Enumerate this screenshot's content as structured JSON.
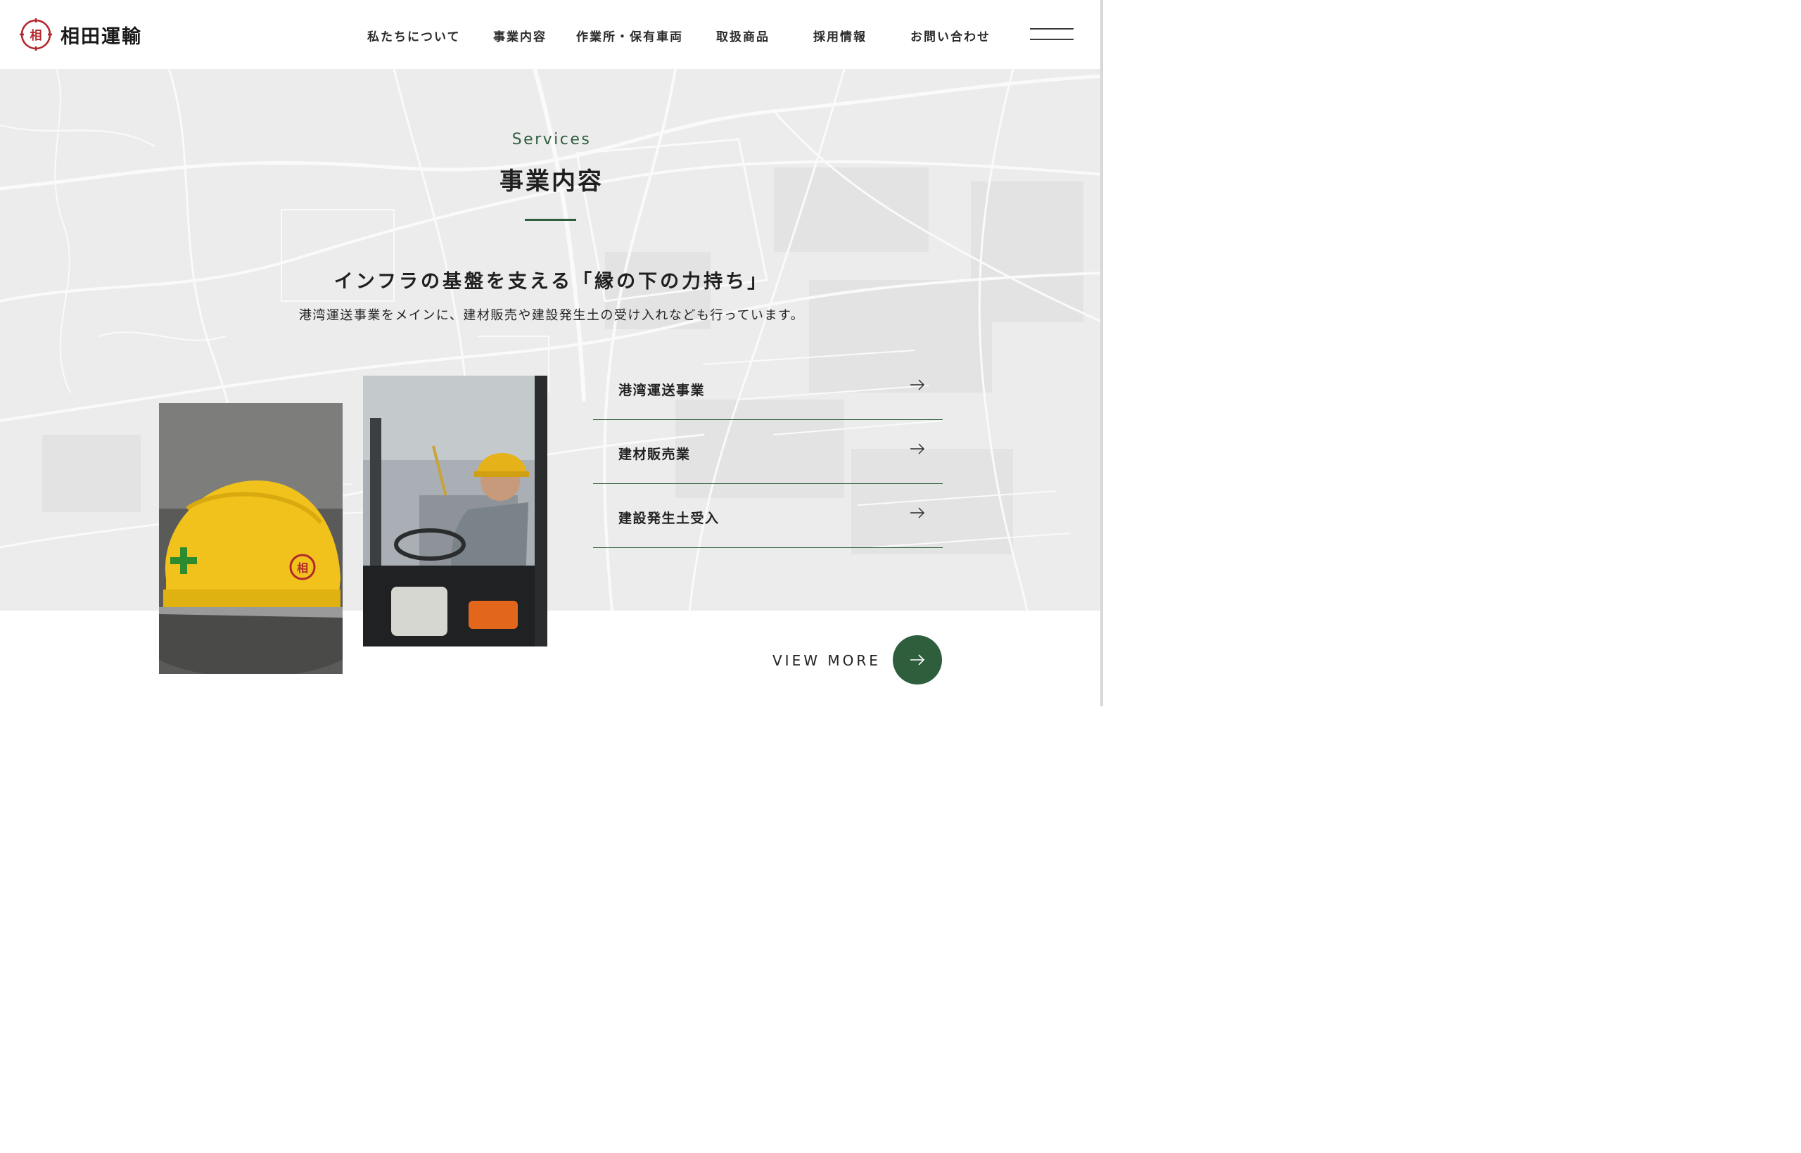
{
  "brand": {
    "name": "相田運輸",
    "mark_char": "相",
    "accent_red": "#b3272d"
  },
  "nav": {
    "items": [
      {
        "label": "私たちについて"
      },
      {
        "label": "事業内容"
      },
      {
        "label": "作業所・保有車両"
      },
      {
        "label": "取扱商品"
      },
      {
        "label": "採用情報"
      },
      {
        "label": "お問い合わせ"
      }
    ],
    "menu_icon": "hamburger-menu-icon"
  },
  "services": {
    "subtitle": "Services",
    "title": "事業内容",
    "lead": "インフラの基盤を支える「縁の下の力持ち」",
    "description": "港湾運送事業をメインに、建材販売や建設発生土の受け入れなども行っています。",
    "items": [
      {
        "label": "港湾運送事業",
        "icon": "arrow-right-icon"
      },
      {
        "label": "建材販売業",
        "icon": "arrow-right-icon"
      },
      {
        "label": "建設発生土受入",
        "icon": "arrow-right-icon"
      }
    ],
    "view_more": "VIEW MORE"
  },
  "colors": {
    "accent_green": "#2f5e3d",
    "section_bg": "#ececec",
    "text": "#222222"
  }
}
